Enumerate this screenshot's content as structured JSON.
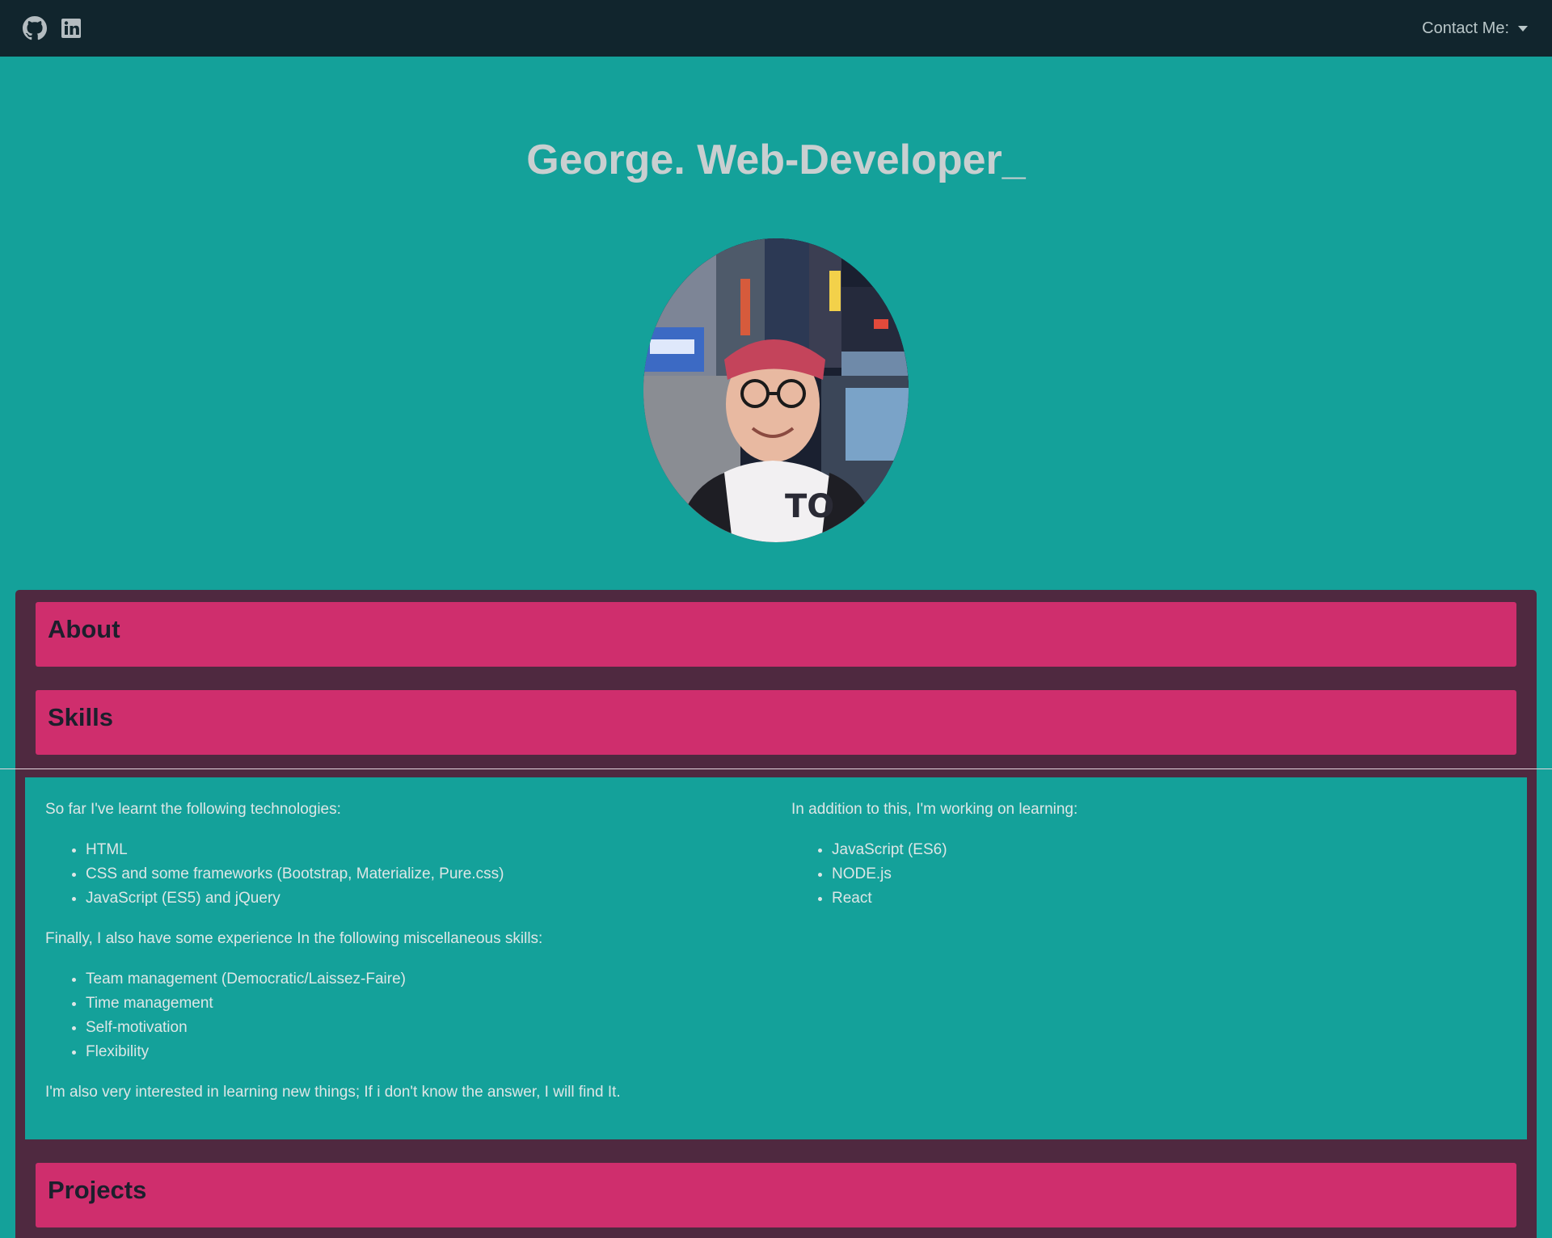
{
  "navbar": {
    "icons": [
      "github-icon",
      "linkedin-icon"
    ],
    "contact_label": "Contact Me:"
  },
  "hero": {
    "title": "George. Web-Developer_"
  },
  "sections": {
    "about": "About",
    "skills": "Skills",
    "projects": "Projects"
  },
  "skills": {
    "learnt_intro": "So far I've learnt the following technologies:",
    "learnt": [
      "HTML",
      "CSS and some frameworks (Bootstrap, Materialize, Pure.css)",
      "JavaScript (ES5) and jQuery"
    ],
    "misc_intro": "Finally, I also have some experience In the following miscellaneous skills:",
    "misc": [
      "Team management (Democratic/Laissez-Faire)",
      "Time management",
      "Self-motivation",
      "Flexibility"
    ],
    "closing": "I'm also very interested in learning new things; If i don't know the answer, I will find It.",
    "learning_intro": "In addition to this, I'm working on learning:",
    "learning": [
      "JavaScript (ES6)",
      "NODE.js",
      "React"
    ]
  },
  "colors": {
    "navbar": "#11252d",
    "page_bg": "#14a19a",
    "container": "#4f2940",
    "section_header": "#cf2e6d",
    "title_text": "#c9cfd0"
  }
}
